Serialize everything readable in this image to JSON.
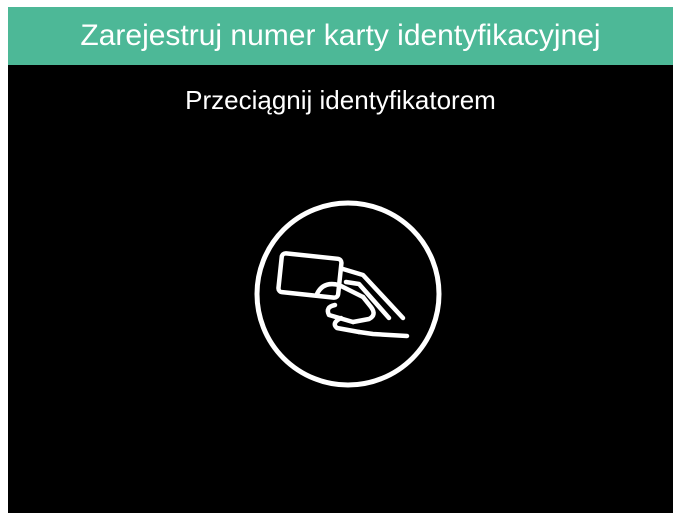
{
  "header": {
    "title": "Zarejestruj numer karty identyfikacyjnej"
  },
  "main": {
    "instruction": "Przeciągnij identyfikatorem",
    "icon": "card-swipe-icon"
  },
  "colors": {
    "header_background": "#4db897",
    "screen_background": "#000000",
    "text": "#ffffff"
  }
}
